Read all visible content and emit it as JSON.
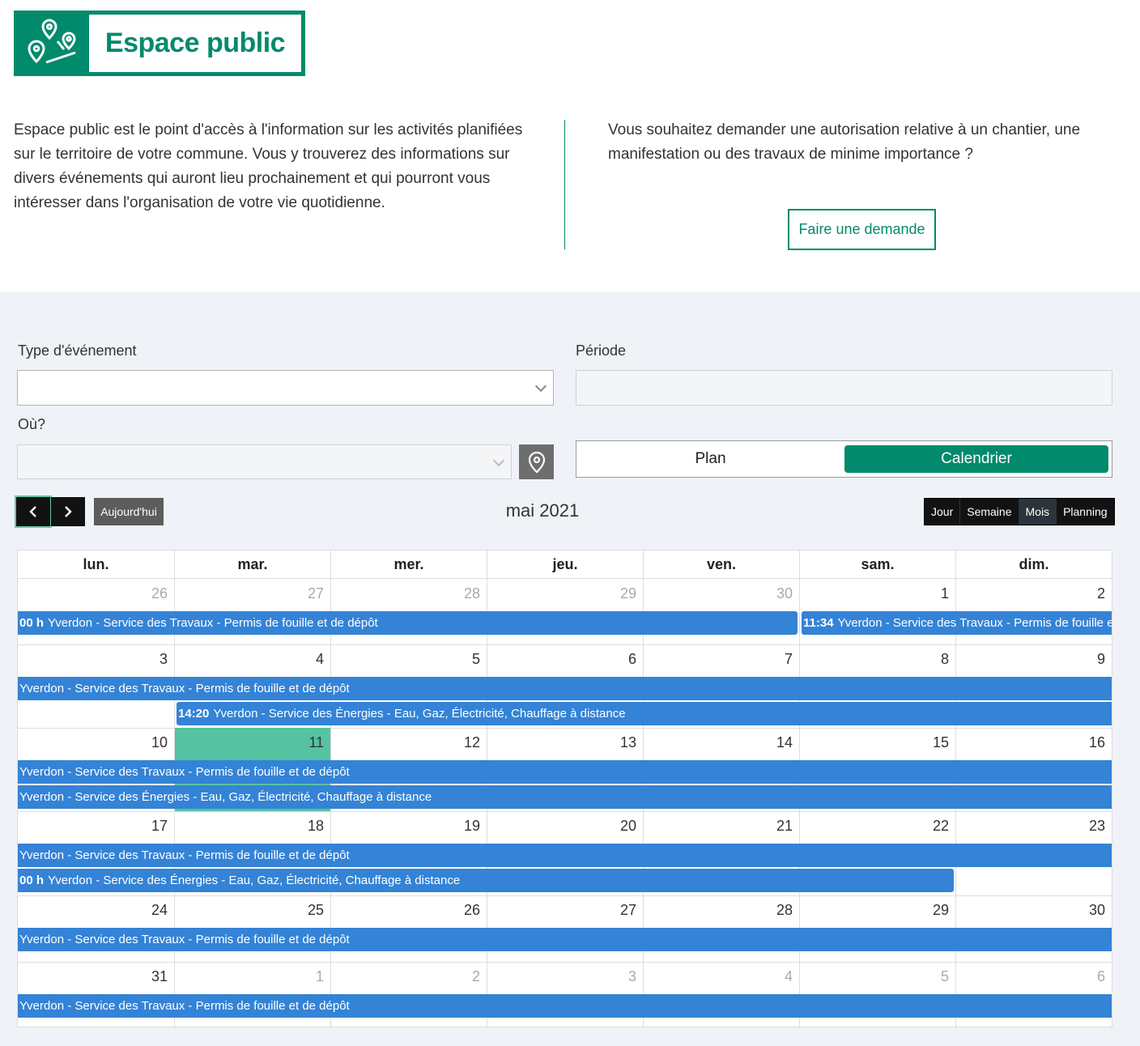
{
  "header": {
    "title": "Espace public",
    "logo_icon": "map-pins-icon",
    "brand_color": "#028a6c"
  },
  "intro": {
    "left_text": "Espace public est le point d'accès à l'information sur les activités planifiées sur le territoire de votre commune. Vous y trouverez des informations sur divers événements qui auront lieu prochainement et qui pourront vous intéresser dans l'organisation de votre vie quotidienne.",
    "right_text": "Vous souhaitez demander une autorisation relative à un chantier, une manifestation ou des travaux de minime importance ?",
    "request_button": "Faire une demande"
  },
  "filters": {
    "event_type_label": "Type d'événement",
    "event_type_value": "",
    "period_label": "Période",
    "period_value": "",
    "where_label": "Où?",
    "where_value": "",
    "location_icon": "location-pin-icon"
  },
  "view_toggle": {
    "plan": "Plan",
    "calendar": "Calendrier",
    "active": "Calendrier"
  },
  "toolbar": {
    "prev_icon": "chevron-left-icon",
    "next_icon": "chevron-right-icon",
    "today": "Aujourd'hui",
    "title": "mai 2021",
    "views": [
      "Jour",
      "Semaine",
      "Mois",
      "Planning"
    ],
    "active_view": "Mois"
  },
  "calendar": {
    "weekdays": [
      "lun.",
      "mar.",
      "mer.",
      "jeu.",
      "ven.",
      "sam.",
      "dim."
    ],
    "weeks": [
      {
        "days": [
          {
            "n": "26",
            "other": true
          },
          {
            "n": "27",
            "other": true
          },
          {
            "n": "28",
            "other": true
          },
          {
            "n": "29",
            "other": true
          },
          {
            "n": "30",
            "other": true
          },
          {
            "n": "1"
          },
          {
            "n": "2"
          }
        ],
        "events": [
          {
            "time": "00 h",
            "title": "Yverdon - Service des Travaux - Permis de fouille et de dépôt",
            "start": 0,
            "end": 5,
            "lane": 0
          },
          {
            "time": "11:34",
            "title": "Yverdon - Service des Travaux - Permis de fouille et de dépôt",
            "start": 5,
            "end": 7,
            "lane": 0
          }
        ]
      },
      {
        "days": [
          {
            "n": "3"
          },
          {
            "n": "4"
          },
          {
            "n": "5"
          },
          {
            "n": "6"
          },
          {
            "n": "7"
          },
          {
            "n": "8"
          },
          {
            "n": "9"
          }
        ],
        "events": [
          {
            "time": "",
            "title": "Yverdon - Service des Travaux - Permis de fouille et de dépôt",
            "start": 0,
            "end": 7,
            "lane": 0
          },
          {
            "time": "14:20",
            "title": "Yverdon - Service des Énergies - Eau, Gaz, Électricité, Chauffage à distance",
            "start": 1,
            "end": 7,
            "lane": 1
          }
        ]
      },
      {
        "days": [
          {
            "n": "10"
          },
          {
            "n": "11",
            "today": true
          },
          {
            "n": "12"
          },
          {
            "n": "13"
          },
          {
            "n": "14"
          },
          {
            "n": "15"
          },
          {
            "n": "16"
          }
        ],
        "events": [
          {
            "time": "",
            "title": "Yverdon - Service des Travaux - Permis de fouille et de dépôt",
            "start": 0,
            "end": 7,
            "lane": 0
          },
          {
            "time": "",
            "title": "Yverdon - Service des Énergies - Eau, Gaz, Électricité, Chauffage à distance",
            "start": 0,
            "end": 7,
            "lane": 1
          }
        ]
      },
      {
        "days": [
          {
            "n": "17"
          },
          {
            "n": "18"
          },
          {
            "n": "19"
          },
          {
            "n": "20"
          },
          {
            "n": "21"
          },
          {
            "n": "22"
          },
          {
            "n": "23"
          }
        ],
        "events": [
          {
            "time": "",
            "title": "Yverdon - Service des Travaux - Permis de fouille et de dépôt",
            "start": 0,
            "end": 7,
            "lane": 0
          },
          {
            "time": "00 h",
            "title": "Yverdon - Service des Énergies - Eau, Gaz, Électricité, Chauffage à distance",
            "start": 0,
            "end": 6,
            "lane": 1
          }
        ]
      },
      {
        "days": [
          {
            "n": "24"
          },
          {
            "n": "25"
          },
          {
            "n": "26"
          },
          {
            "n": "27"
          },
          {
            "n": "28"
          },
          {
            "n": "29"
          },
          {
            "n": "30"
          }
        ],
        "events": [
          {
            "time": "",
            "title": "Yverdon - Service des Travaux - Permis de fouille et de dépôt",
            "start": 0,
            "end": 7,
            "lane": 0
          }
        ]
      },
      {
        "days": [
          {
            "n": "31"
          },
          {
            "n": "1",
            "other": true
          },
          {
            "n": "2",
            "other": true
          },
          {
            "n": "3",
            "other": true
          },
          {
            "n": "4",
            "other": true
          },
          {
            "n": "5",
            "other": true
          },
          {
            "n": "6",
            "other": true
          }
        ],
        "events": [
          {
            "time": "",
            "title": "Yverdon - Service des Travaux - Permis de fouille et de dépôt",
            "start": 0,
            "end": 7,
            "lane": 0
          }
        ]
      }
    ],
    "event_color": "#3483d6",
    "today_color": "#55c3a1"
  }
}
